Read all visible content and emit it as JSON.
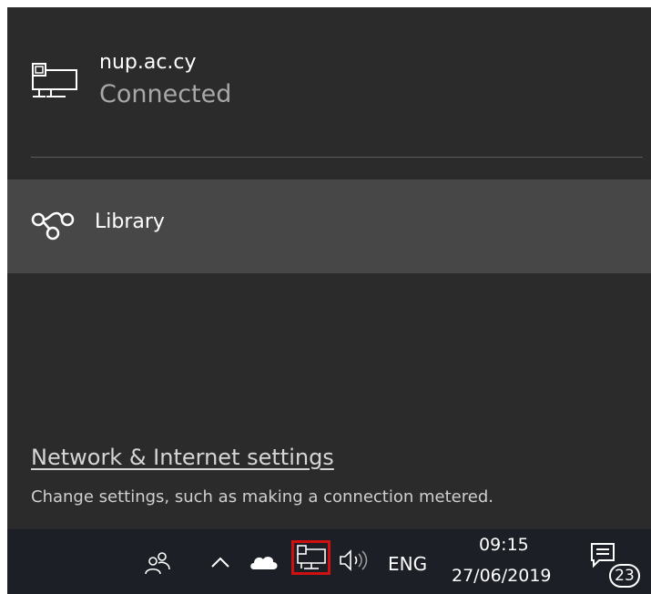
{
  "flyout": {
    "connection": {
      "icon": "ethernet-network-icon",
      "name": "nup.ac.cy",
      "status": "Connected"
    },
    "vpn": {
      "icon": "vpn-icon",
      "label": "Library"
    },
    "settings": {
      "link_label": "Network & Internet settings",
      "description": "Change settings, such as making a connection metered."
    }
  },
  "taskbar": {
    "icons": [
      "people-icon",
      "chevron-up-icon",
      "onedrive-cloud-icon",
      "network-icon",
      "volume-icon",
      "action-center-icon"
    ],
    "language": "ENG",
    "time": "09:15",
    "date": "27/06/2019",
    "notification_count": "23"
  },
  "colors": {
    "flyout_bg": "#2b2b2b",
    "selected_item_bg": "#474747",
    "taskbar_bg": "#1c2026",
    "highlight": "#d01010"
  }
}
